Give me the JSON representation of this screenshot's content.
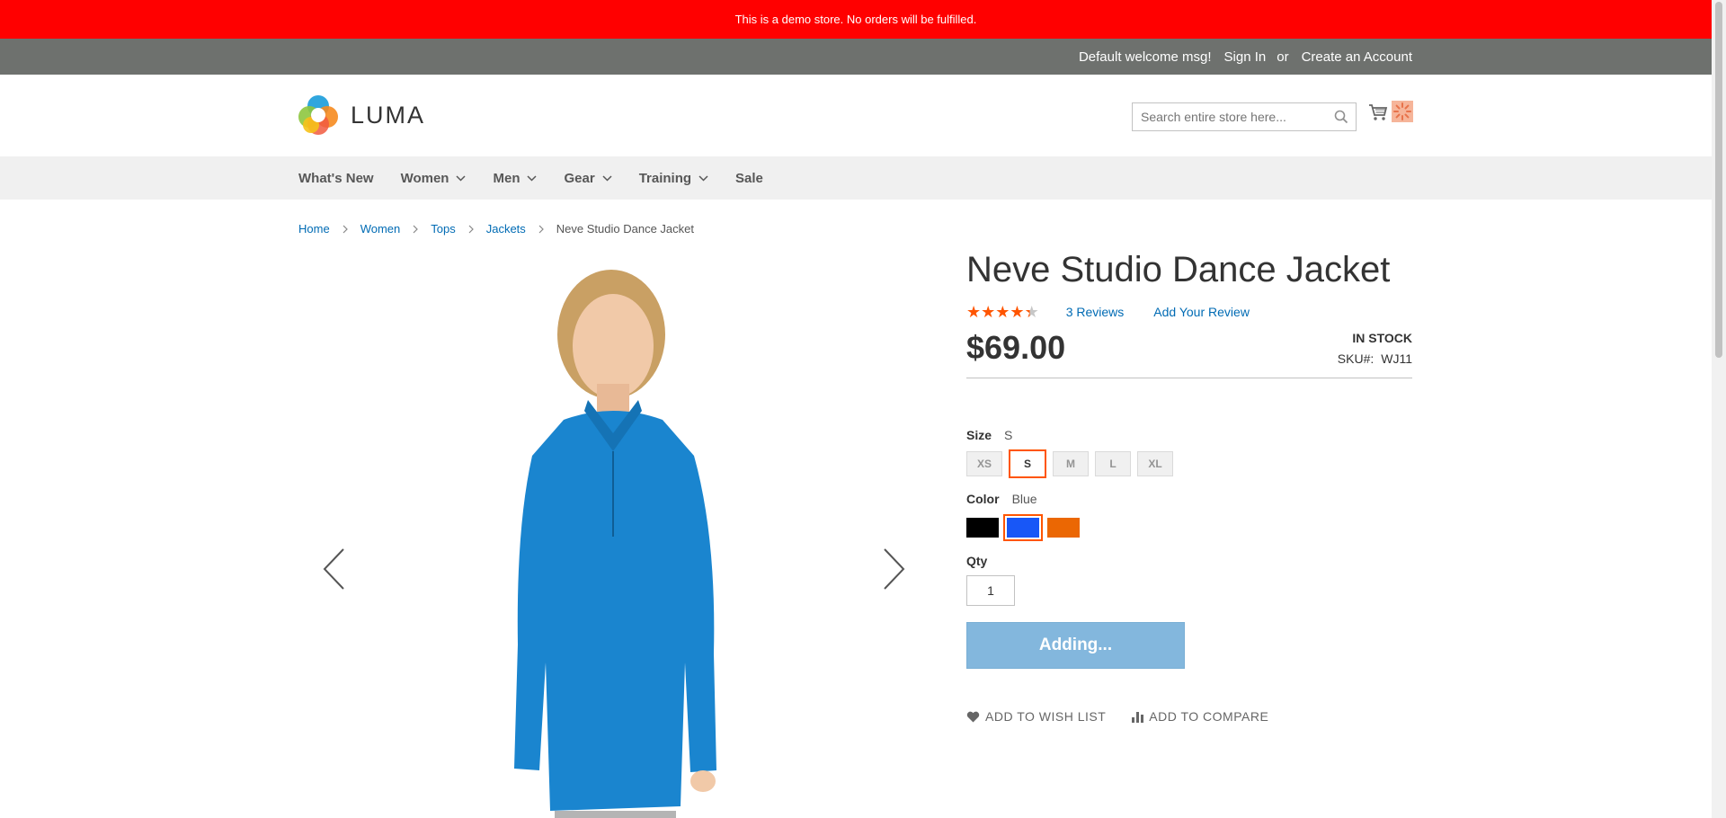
{
  "demo_notice": "This is a demo store. No orders will be fulfilled.",
  "header_links": {
    "welcome": "Default welcome msg!",
    "sign_in": "Sign In",
    "or": "or",
    "create_account": "Create an Account"
  },
  "logo": {
    "text": "LUMA"
  },
  "search": {
    "placeholder": "Search entire store here..."
  },
  "nav": {
    "items": [
      {
        "label": "What's New"
      },
      {
        "label": "Women"
      },
      {
        "label": "Men"
      },
      {
        "label": "Gear"
      },
      {
        "label": "Training"
      },
      {
        "label": "Sale"
      }
    ]
  },
  "breadcrumbs": {
    "items": [
      {
        "label": "Home"
      },
      {
        "label": "Women"
      },
      {
        "label": "Tops"
      },
      {
        "label": "Jackets"
      }
    ],
    "current": "Neve Studio Dance Jacket"
  },
  "product": {
    "title": "Neve Studio Dance Jacket",
    "rating_stars": 4.3,
    "reviews_link": "3  Reviews",
    "add_review": "Add Your Review",
    "price": "$69.00",
    "stock": "IN STOCK",
    "sku_label": "SKU#:",
    "sku_value": "WJ11"
  },
  "options": {
    "size": {
      "label": "Size",
      "selected": "S",
      "values": [
        "XS",
        "S",
        "M",
        "L",
        "XL"
      ]
    },
    "color": {
      "label": "Color",
      "selected": "Blue",
      "swatches": [
        "#000000",
        "#1857f7",
        "#eb6703"
      ]
    }
  },
  "qty": {
    "label": "Qty",
    "value": "1"
  },
  "add_to_cart": "Adding...",
  "actions": {
    "wishlist": "Add to Wish List",
    "compare": "Add to Compare"
  },
  "colors": {
    "notice": "#ff0000",
    "accent": "#ff5501",
    "link": "#006bb4",
    "button": "#83b7dd"
  }
}
